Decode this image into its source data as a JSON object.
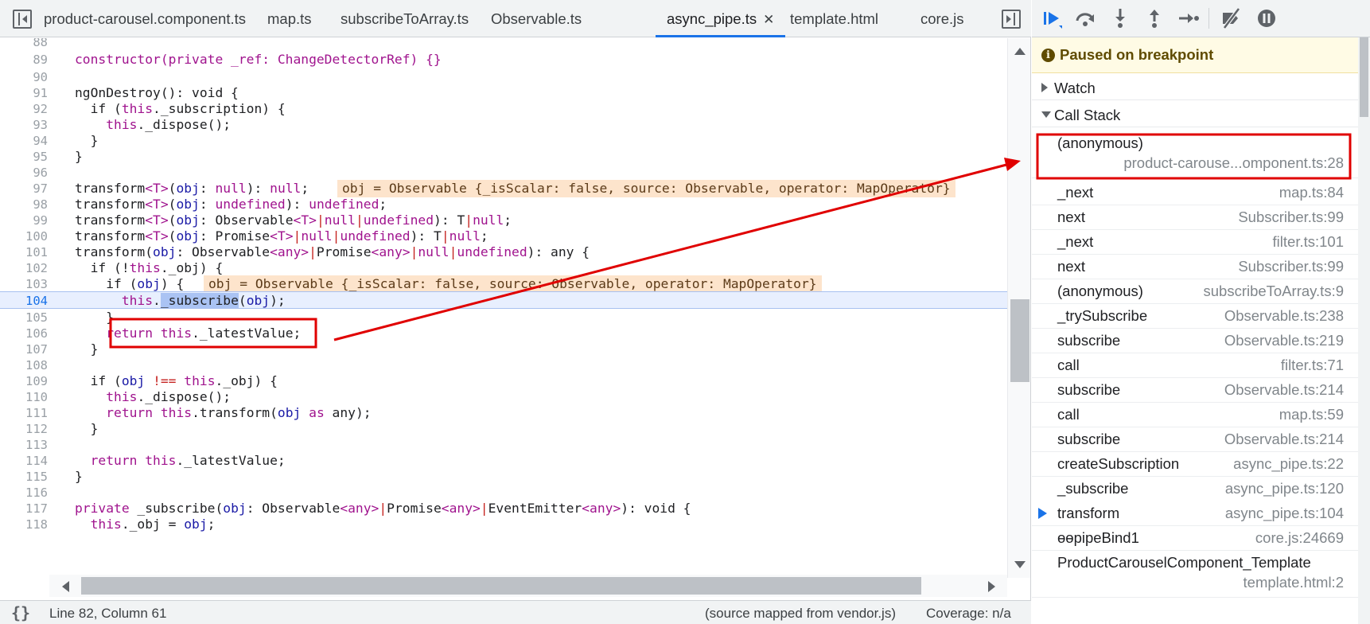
{
  "tabs": [
    {
      "label": "product-carousel.component.ts",
      "active": false
    },
    {
      "label": "map.ts",
      "active": false
    },
    {
      "label": "subscribeToArray.ts",
      "active": false
    },
    {
      "label": "Observable.ts",
      "active": false
    },
    {
      "label": "async_pipe.ts",
      "active": true,
      "close": "✕"
    },
    {
      "label": "template.html",
      "active": false
    },
    {
      "label": "core.js",
      "active": false
    }
  ],
  "code": {
    "current_line": "104",
    "lines": [
      {
        "n": "88"
      },
      {
        "n": "89"
      },
      {
        "n": "90"
      },
      {
        "n": "91"
      },
      {
        "n": "92"
      },
      {
        "n": "93"
      },
      {
        "n": "94"
      },
      {
        "n": "95"
      },
      {
        "n": "96"
      },
      {
        "n": "97"
      },
      {
        "n": "98"
      },
      {
        "n": "99"
      },
      {
        "n": "100"
      },
      {
        "n": "101"
      },
      {
        "n": "102"
      },
      {
        "n": "103"
      },
      {
        "n": "104"
      },
      {
        "n": "105"
      },
      {
        "n": "106"
      },
      {
        "n": "107"
      },
      {
        "n": "108"
      },
      {
        "n": "109"
      },
      {
        "n": "110"
      },
      {
        "n": "111"
      },
      {
        "n": "112"
      },
      {
        "n": "113"
      },
      {
        "n": "114"
      },
      {
        "n": "115"
      },
      {
        "n": "116"
      },
      {
        "n": "117"
      },
      {
        "n": "118"
      }
    ],
    "text": {
      "l89": "constructor(private _ref: ChangeDetectorRef) {}",
      "l91": "ngOnDestroy(): void {",
      "l92_a": "  if (",
      "l92_b": "this",
      "l92_c": "._subscription) {",
      "l93_a": "    ",
      "l93_b": "this",
      "l93_c": "._dispose();",
      "l94": "  }",
      "l95": "}",
      "l97_a": "transform",
      "l97_b": "<T>",
      "l97_c": "(",
      "l97_d": "obj",
      "l97_e": ": ",
      "l97_f": "null",
      "l97_g": "): ",
      "l97_h": "null",
      "l97_i": ";",
      "l97_val": "obj = Observable {_isScalar: false, source: Observable, operator: MapOperator}",
      "l98_a": "transform",
      "l98_b": "<T>",
      "l98_c": "(",
      "l98_d": "obj",
      "l98_e": ": ",
      "l98_f": "undefined",
      "l98_g": "): ",
      "l98_h": "undefined",
      "l98_i": ";",
      "l99_a": "transform",
      "l99_b": "<T>",
      "l99_c": "(",
      "l99_d": "obj",
      "l99_e": ": Observable",
      "l99_f": "<T>",
      "l99_g": "|",
      "l99_h": "null",
      "l99_i": "|",
      "l99_j": "undefined",
      "l99_k": "): T",
      "l99_l": "|",
      "l99_m": "null",
      "l99_n": ";",
      "l100_a": "transform",
      "l100_b": "<T>",
      "l100_c": "(",
      "l100_d": "obj",
      "l100_e": ": Promise",
      "l100_f": "<T>",
      "l100_g": "|",
      "l100_h": "null",
      "l100_i": "|",
      "l100_j": "undefined",
      "l100_k": "): T",
      "l100_l": "|",
      "l100_m": "null",
      "l100_n": ";",
      "l101_a": "transform(",
      "l101_b": "obj",
      "l101_c": ": Observable",
      "l101_d": "<any>",
      "l101_e": "|",
      "l101_f": "Promise",
      "l101_g": "<any>",
      "l101_h": "|",
      "l101_i": "null",
      "l101_j": "|",
      "l101_k": "undefined",
      "l101_l": "): any {",
      "l102_a": "  if (!",
      "l102_b": "this",
      "l102_c": "._obj) {",
      "l103_a": "    if (",
      "l103_b": "obj",
      "l103_c": ") {",
      "l103_val": "obj = Observable {_isScalar: false, source: Observable, operator: MapOperator}",
      "l104_a": "      ",
      "l104_b": "this",
      "l104_c": ".",
      "l104_d": "_subscribe",
      "l104_e": "(",
      "l104_f": "obj",
      "l104_g": ");",
      "l105": "    }",
      "l106_a": "    ",
      "l106_b": "return",
      "l106_c": " ",
      "l106_d": "this",
      "l106_e": "._latestValue;",
      "l107": "  }",
      "l109_a": "  if (",
      "l109_b": "obj",
      "l109_c": " ",
      "l109_d": "!==",
      "l109_e": " ",
      "l109_f": "this",
      "l109_g": "._obj) {",
      "l110_a": "    ",
      "l110_b": "this",
      "l110_c": "._dispose();",
      "l111_a": "    ",
      "l111_b": "return",
      "l111_c": " ",
      "l111_d": "this",
      "l111_e": ".transform(",
      "l111_f": "obj",
      "l111_g": " ",
      "l111_h": "as",
      "l111_i": " any);",
      "l112": "  }",
      "l114_a": "  ",
      "l114_b": "return",
      "l114_c": " ",
      "l114_d": "this",
      "l114_e": "._latestValue;",
      "l115": "}",
      "l117_a": "private",
      "l117_b": " _subscribe(",
      "l117_c": "obj",
      "l117_d": ": Observable",
      "l117_e": "<any>",
      "l117_f": "|",
      "l117_g": "Promise",
      "l117_h": "<any>",
      "l117_i": "|",
      "l117_j": "EventEmitter",
      "l117_k": "<any>",
      "l117_l": "): void {",
      "l118_a": "  ",
      "l118_b": "this",
      "l118_c": "._obj = ",
      "l118_d": "obj",
      "l118_e": ";"
    }
  },
  "footer": {
    "pretty_print": "{}",
    "position": "Line 82, Column 61",
    "source": "(source mapped from vendor.js)",
    "coverage": "Coverage: n/a"
  },
  "debugger": {
    "paused_icon": "i",
    "paused": "Paused on breakpoint",
    "watch": "Watch",
    "call_stack": "Call Stack",
    "frames": [
      {
        "fn": "(anonymous)",
        "loc": "product-carouse...omponent.ts:28"
      },
      {
        "fn": "_next",
        "loc": "map.ts:84"
      },
      {
        "fn": "next",
        "loc": "Subscriber.ts:99"
      },
      {
        "fn": "_next",
        "loc": "filter.ts:101"
      },
      {
        "fn": "next",
        "loc": "Subscriber.ts:99"
      },
      {
        "fn": "(anonymous)",
        "loc": "subscribeToArray.ts:9"
      },
      {
        "fn": "_trySubscribe",
        "loc": "Observable.ts:238"
      },
      {
        "fn": "subscribe",
        "loc": "Observable.ts:219"
      },
      {
        "fn": "call",
        "loc": "filter.ts:71"
      },
      {
        "fn": "subscribe",
        "loc": "Observable.ts:214"
      },
      {
        "fn": "call",
        "loc": "map.ts:59"
      },
      {
        "fn": "subscribe",
        "loc": "Observable.ts:214"
      },
      {
        "fn": "createSubscription",
        "loc": "async_pipe.ts:22"
      },
      {
        "fn": "_subscribe",
        "loc": "async_pipe.ts:120"
      },
      {
        "fn": "transform",
        "loc": "async_pipe.ts:104"
      },
      {
        "fn": "ɵɵpipeBind1",
        "loc": "core.js:24669"
      },
      {
        "fn": "ProductCarouselComponent_Template",
        "loc": "template.html:2"
      }
    ]
  },
  "colors": {
    "accent": "#1a73e8",
    "annotation": "#e00000",
    "inline_value_bg": "#fde4cc",
    "paused_banner_bg": "#fffbe5"
  }
}
